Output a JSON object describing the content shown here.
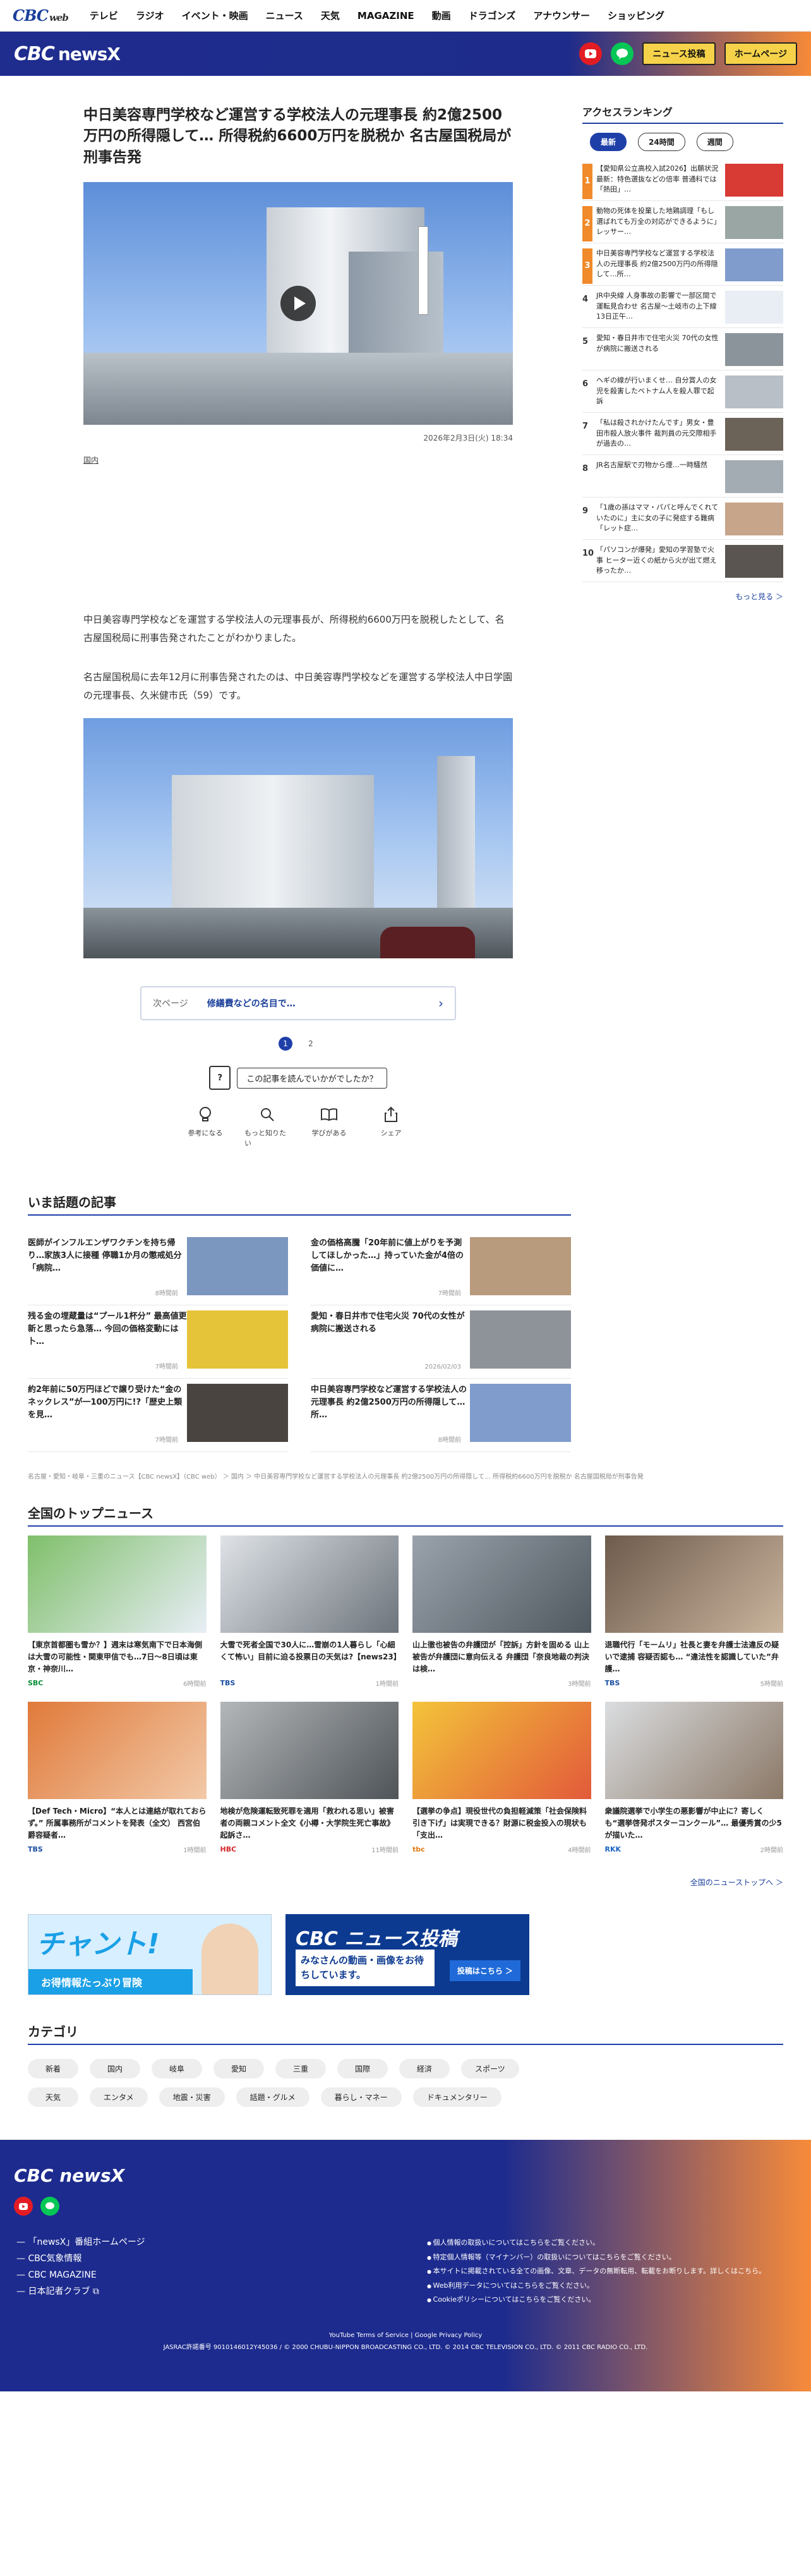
{
  "global_nav": {
    "logo_main": "CBC",
    "logo_sub": "web",
    "items": [
      "テレビ",
      "ラジオ",
      "イベント・映画",
      "ニュース",
      "天気",
      "MAGAZINE",
      "動画",
      "ドラゴンズ",
      "アナウンサー",
      "ショッピング"
    ]
  },
  "header": {
    "logo": "CBC",
    "logo_x": "newsX",
    "post_btn": "ニュース投稿",
    "home_btn": "ホームページ"
  },
  "article": {
    "title": "中日美容専門学校など運営する学校法人の元理事長 約2億2500万円の所得隠して… 所得税約6600万円を脱税か 名古屋国税局が刑事告発",
    "date": "2026年2月3日(火) 18:34",
    "category": "国内",
    "para1": "中日美容専門学校などを運営する学校法人の元理事長が、所得税約6600万円を脱税したとして、名古屋国税局に刑事告発されたことがわかりました。",
    "para2": "名古屋国税局に去年12月に刑事告発されたのは、中日美容専門学校などを運営する学校法人中日学園の元理事長、久米健市氏（59）です。",
    "next_label": "次ページ",
    "next_title": "修繕費などの名目で…",
    "pages": [
      "1",
      "2"
    ],
    "reaction_q": "この記事を読んでいかがでしたか？",
    "reaction_icon": "?",
    "reactions": [
      "参考になる",
      "もっと知りたい",
      "学びがある",
      "シェア"
    ]
  },
  "ranking": {
    "title": "アクセスランキング",
    "tabs": [
      "最新",
      "24時間",
      "週間"
    ],
    "items": [
      {
        "num": "1",
        "text": "【愛知県公立高校入試2026】出願状況最新：特色選抜などの倍率 普通科では「熱田」…"
      },
      {
        "num": "2",
        "text": "動物の死体を投棄した地鶏調理「もし選ばれても万全の対応ができるように」レッサー…"
      },
      {
        "num": "3",
        "text": "中日美容専門学校など運営する学校法人の元理事長 約2億2500万円の所得隠して…所…"
      },
      {
        "num": "4",
        "text": "JR中央線 人身事故の影響で一部区間で運転見合わせ 名古屋〜土岐市の上下線 13日正午…"
      },
      {
        "num": "5",
        "text": "愛知・春日井市で住宅火災 70代の女性が病院に搬送される"
      },
      {
        "num": "6",
        "text": "ヘギの線が行いまくせ… 自分賞人の女児を殺害したベトナム人を殺人罪で起訴"
      },
      {
        "num": "7",
        "text": "「私は殺されかけたんです」男女・豊田市殺人放火事件 裁判員の元交際相手が過去の…"
      },
      {
        "num": "8",
        "text": "JR名古屋駅で刃物から煙…一時騒然"
      },
      {
        "num": "9",
        "text": "「1歳の孫はママ・パパと呼んでくれていたのに」主に女の子に発症する難病「レット症…"
      },
      {
        "num": "10",
        "text": "「パソコンが爆発」愛知の学習塾で火事 ヒーター近くの紙から火が出て燃え移ったか…"
      }
    ],
    "more": "もっと見る ＞"
  },
  "topics": {
    "title": "いま話題の記事",
    "items": [
      {
        "title": "医師がインフルエンザワクチンを持ち帰り…家族3人に接種 停職1か月の懲戒処分「病院…",
        "date": "8時間前"
      },
      {
        "title": "金の価格高騰「20年前に値上がりを予測してほしかった…」持っていた金が4倍の価値に…",
        "date": "7時間前"
      },
      {
        "title": "残る金の埋蔵量は“プール1杯分” 最高値更新と思ったら急落… 今回の価格変動には卜…",
        "date": "7時間前"
      },
      {
        "title": "愛知・春日井市で住宅火災 70代の女性が病院に搬送される",
        "date": "2026/02/03"
      },
      {
        "title": "約2年前に50万円ほどで譲り受けた“金のネックレス”が一100万円に!?「歴史上類を見…",
        "date": "7時間前"
      },
      {
        "title": "中日美容専門学校など運営する学校法人の元理事長 約2億2500万円の所得隠して… 所…",
        "date": "8時間前"
      }
    ]
  },
  "breadcrumb": "名古屋・愛知・岐阜・三重のニュース【CBC newsX】（CBC web） ＞ 国内 ＞ 中日美容専門学校など運営する学校法人の元理事長 約2億2500万円の所得隠して… 所得税約6600万円を脱税か 名古屋国税局が刑事告発",
  "national": {
    "title": "全国のトップニュース",
    "items": [
      {
        "title": "【東京首都圏も雪か？】週末は寒気南下で日本海側は大雪の可能性・関東甲信でも…7日〜8日頃は東京・神奈川…",
        "src": "SBC",
        "src_color": "#0b8f3a",
        "date": "6時間前"
      },
      {
        "title": "大雪で死者全国で30人に…雪崩の1人暮らし「心細くて怖い」目前に迫る投票日の天気は?【news23】",
        "src": "TBS",
        "src_color": "#1a4fa0",
        "date": "1時間前"
      },
      {
        "title": "山上徹也被告の弁護団が「控訴」方針を固める 山上被告が弁護団に意向伝える 弁護団「奈良地裁の判決は検…",
        "src": "",
        "src_color": "#333333",
        "date": "3時間前"
      },
      {
        "title": "退職代行「モームリ」社長と妻を弁護士法違反の疑いで逮捕 容疑否認も… “違法性を認識していた”弁護…",
        "src": "TBS",
        "src_color": "#1a4fa0",
        "date": "5時間前"
      },
      {
        "title": "【Def Tech・Micro】“本人とは連絡が取れておらず。” 所属事務所がコメントを発表（全文） 西宮伯爵容疑者…",
        "src": "TBS",
        "src_color": "#1a4fa0",
        "date": "1時間前"
      },
      {
        "title": "地検が危険運転致死罪を適用「救われる思い」被害者の両親コメント全文《小樽・大学院生死亡事故》起訴さ…",
        "src": "HBC",
        "src_color": "#d4262b",
        "date": "11時間前"
      },
      {
        "title": "【選挙の争点】現役世代の負担軽減策「社会保険料引き下げ」は実現できる？財源に税金投入の現状も 「支出…",
        "src": "tbc",
        "src_color": "#e07a12",
        "date": "4時間前"
      },
      {
        "title": "衆議院選挙で小学生の悪影響が中止に？寄しくも“選挙啓発ポスターコンクール”… 最優秀賞の少5が描いた…",
        "src": "RKK",
        "src_color": "#1b64c4",
        "date": "2時間前"
      }
    ],
    "more": "全国のニューストップへ ＞"
  },
  "banners": {
    "chant_title": "チャント!",
    "chant_sub": "お得情報たっぷり冒険",
    "post_title": "CBC ニュース投稿",
    "post_sub": "みなさんの動画・画像をお待ちしています。",
    "post_btn": "投稿はこちら ＞"
  },
  "categories": {
    "title": "カテゴリ",
    "items": [
      "新着",
      "国内",
      "岐阜",
      "愛知",
      "三重",
      "国際",
      "経済",
      "スポーツ",
      "天気",
      "エンタメ",
      "地震・災害",
      "話題・グルメ",
      "暮らし・マネー",
      "ドキュメンタリー"
    ]
  },
  "footer": {
    "logo": "CBC newsX",
    "links": [
      "「newsX」番組ホームページ",
      "CBC気象情報",
      "CBC MAGAZINE",
      "日本記者クラブ"
    ],
    "notes": [
      "個人情報の取扱いについてはこちらをご覧ください。",
      "特定個人情報等（マイナンバー）の取扱いについてはこちらをご覧ください。",
      "本サイトに掲載されている全ての画像、文章、データの無断転用、転載をお断りします。詳しくはこちら。",
      "Web利用データについてはこちらをご覧ください。",
      "Cookieポリシーについてはこちらをご覧ください。"
    ],
    "policies": "YouTube Terms of Service | Google Privacy Policy",
    "copyright": "JASRAC許諾番号 9010146012Y45036 / © 2000 CHUBU-NIPPON BROADCASTING CO., LTD. © 2014 CBC TELEVISION CO., LTD. © 2011 CBC RADIO CO., LTD."
  },
  "colors": {
    "brand_navy": "#1f2d8f",
    "accent_orange": "#f78a38",
    "link_blue": "#1a3f9b"
  }
}
